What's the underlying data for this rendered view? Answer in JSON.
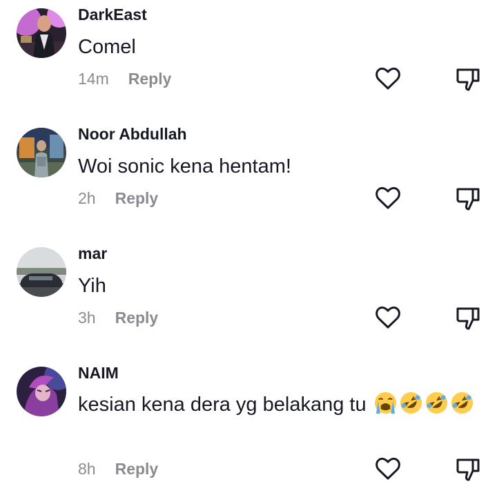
{
  "reply_label": "Reply",
  "comments": [
    {
      "username": "DarkEast",
      "text": "Comel",
      "time": "14m"
    },
    {
      "username": "Noor Abdullah",
      "text": "Woi sonic kena hentam!",
      "time": "2h"
    },
    {
      "username": "mar",
      "text": "Yih",
      "time": "3h"
    },
    {
      "username": "NAIM",
      "text": "kesian kena dera yg belakang tu",
      "time": "8h",
      "emojis": [
        "loudly-crying-face",
        "rolling-on-floor-laughing",
        "rolling-on-floor-laughing",
        "rolling-on-floor-laughing"
      ]
    }
  ],
  "icons": {
    "like": "heart-outline-icon",
    "dislike": "thumbs-down-outline-icon"
  },
  "colors": {
    "text": "#161823",
    "muted": "#8a8b91",
    "icon": "#161823",
    "background": "#ffffff"
  }
}
